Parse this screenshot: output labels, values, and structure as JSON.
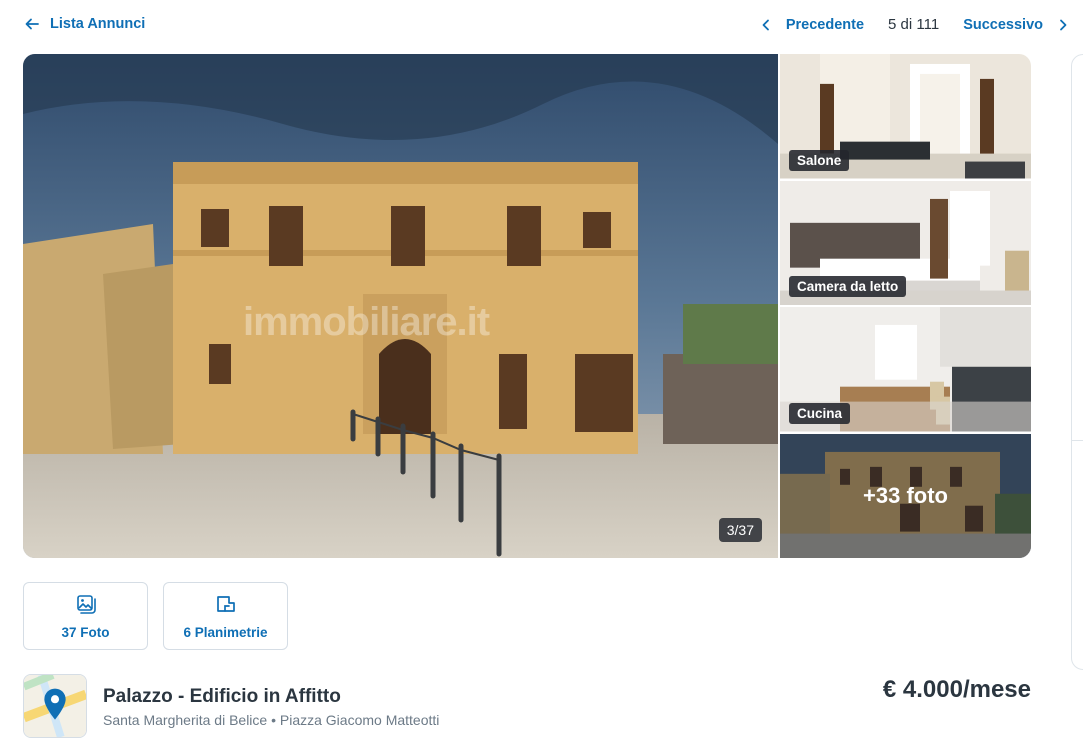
{
  "nav": {
    "back_label": "Lista Annunci",
    "prev_label": "Precedente",
    "counter": "5 di 111",
    "next_label": "Successivo"
  },
  "gallery": {
    "photo_counter": "3/37",
    "watermark": "immobiliare.it",
    "thumbs": [
      {
        "label": "Salone"
      },
      {
        "label": "Camera da letto"
      },
      {
        "label": "Cucina"
      },
      {
        "label": "+33 foto"
      }
    ]
  },
  "media_buttons": {
    "photos_label": "37 Foto",
    "plans_label": "6 Planimetrie"
  },
  "listing": {
    "title": "Palazzo - Edificio in Affitto",
    "location": "Santa Margherita di Belice • Piazza Giacomo Matteotti",
    "price": "€ 4.000/mese"
  },
  "colors": {
    "accent": "#0f6fb5",
    "text": "#2b3640",
    "muted": "#6c7a87"
  },
  "icons": {
    "back": "arrow-left-icon",
    "prev": "chevron-left-icon",
    "next": "chevron-right-icon",
    "photos": "photo-gallery-icon",
    "plans": "floor-plan-icon",
    "map": "map-pin-icon"
  }
}
